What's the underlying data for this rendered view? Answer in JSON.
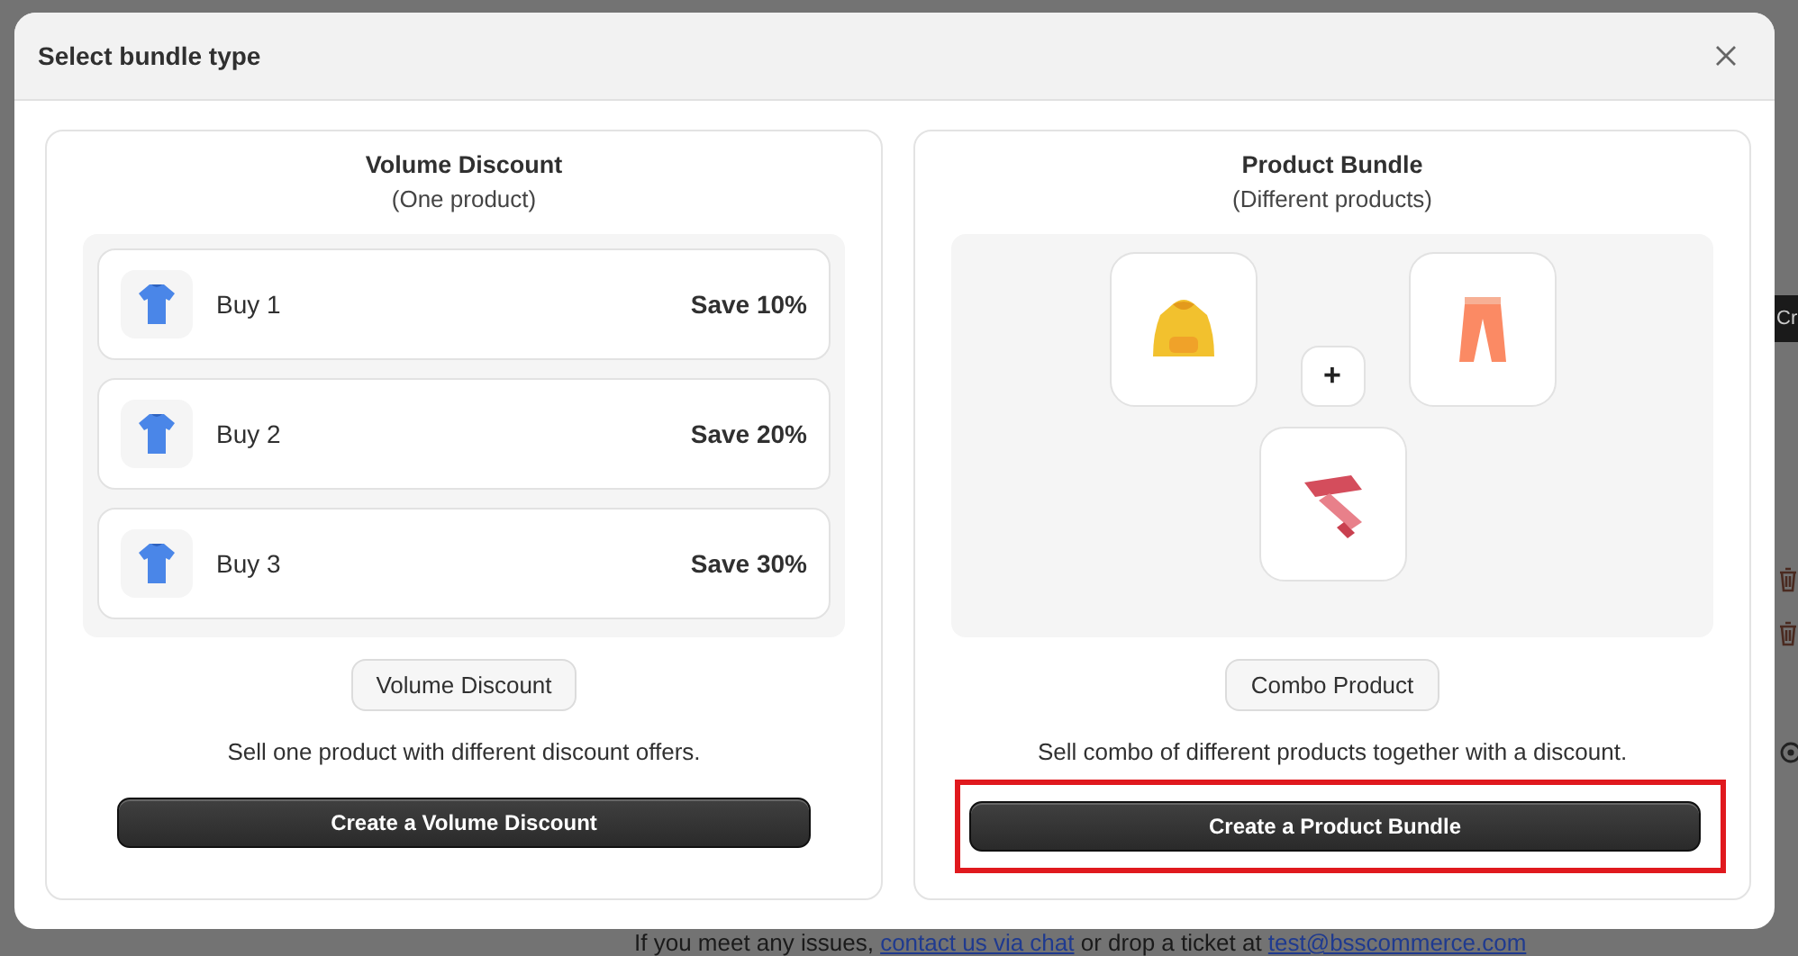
{
  "dialog": {
    "title": "Select bundle type"
  },
  "options": [
    {
      "kind": "tiers",
      "title": "Volume Discount",
      "subtitle": "(One product)",
      "tiers": [
        {
          "label": "Buy 1",
          "saving": "Save 10%"
        },
        {
          "label": "Buy 2",
          "saving": "Save 20%"
        },
        {
          "label": "Buy 3",
          "saving": "Save 30%"
        }
      ],
      "tag": "Volume Discount",
      "description": "Sell one product with different discount offers.",
      "action": "Create a Volume Discount",
      "highlighted": false
    },
    {
      "kind": "combo",
      "title": "Product Bundle",
      "subtitle": "(Different products)",
      "plus": "+",
      "tag": "Combo Product",
      "description": "Sell combo of different products together with a discount.",
      "action": "Create a Product Bundle",
      "highlighted": true
    }
  ],
  "background": {
    "side_button": "Cr",
    "footer": [
      {
        "kind": "text",
        "text": "If you meet any issues, "
      },
      {
        "kind": "link",
        "text": "contact us via chat"
      },
      {
        "kind": "text",
        "text": " or drop a ticket at "
      },
      {
        "kind": "link",
        "text": "test@bsscommerce.com"
      }
    ]
  }
}
